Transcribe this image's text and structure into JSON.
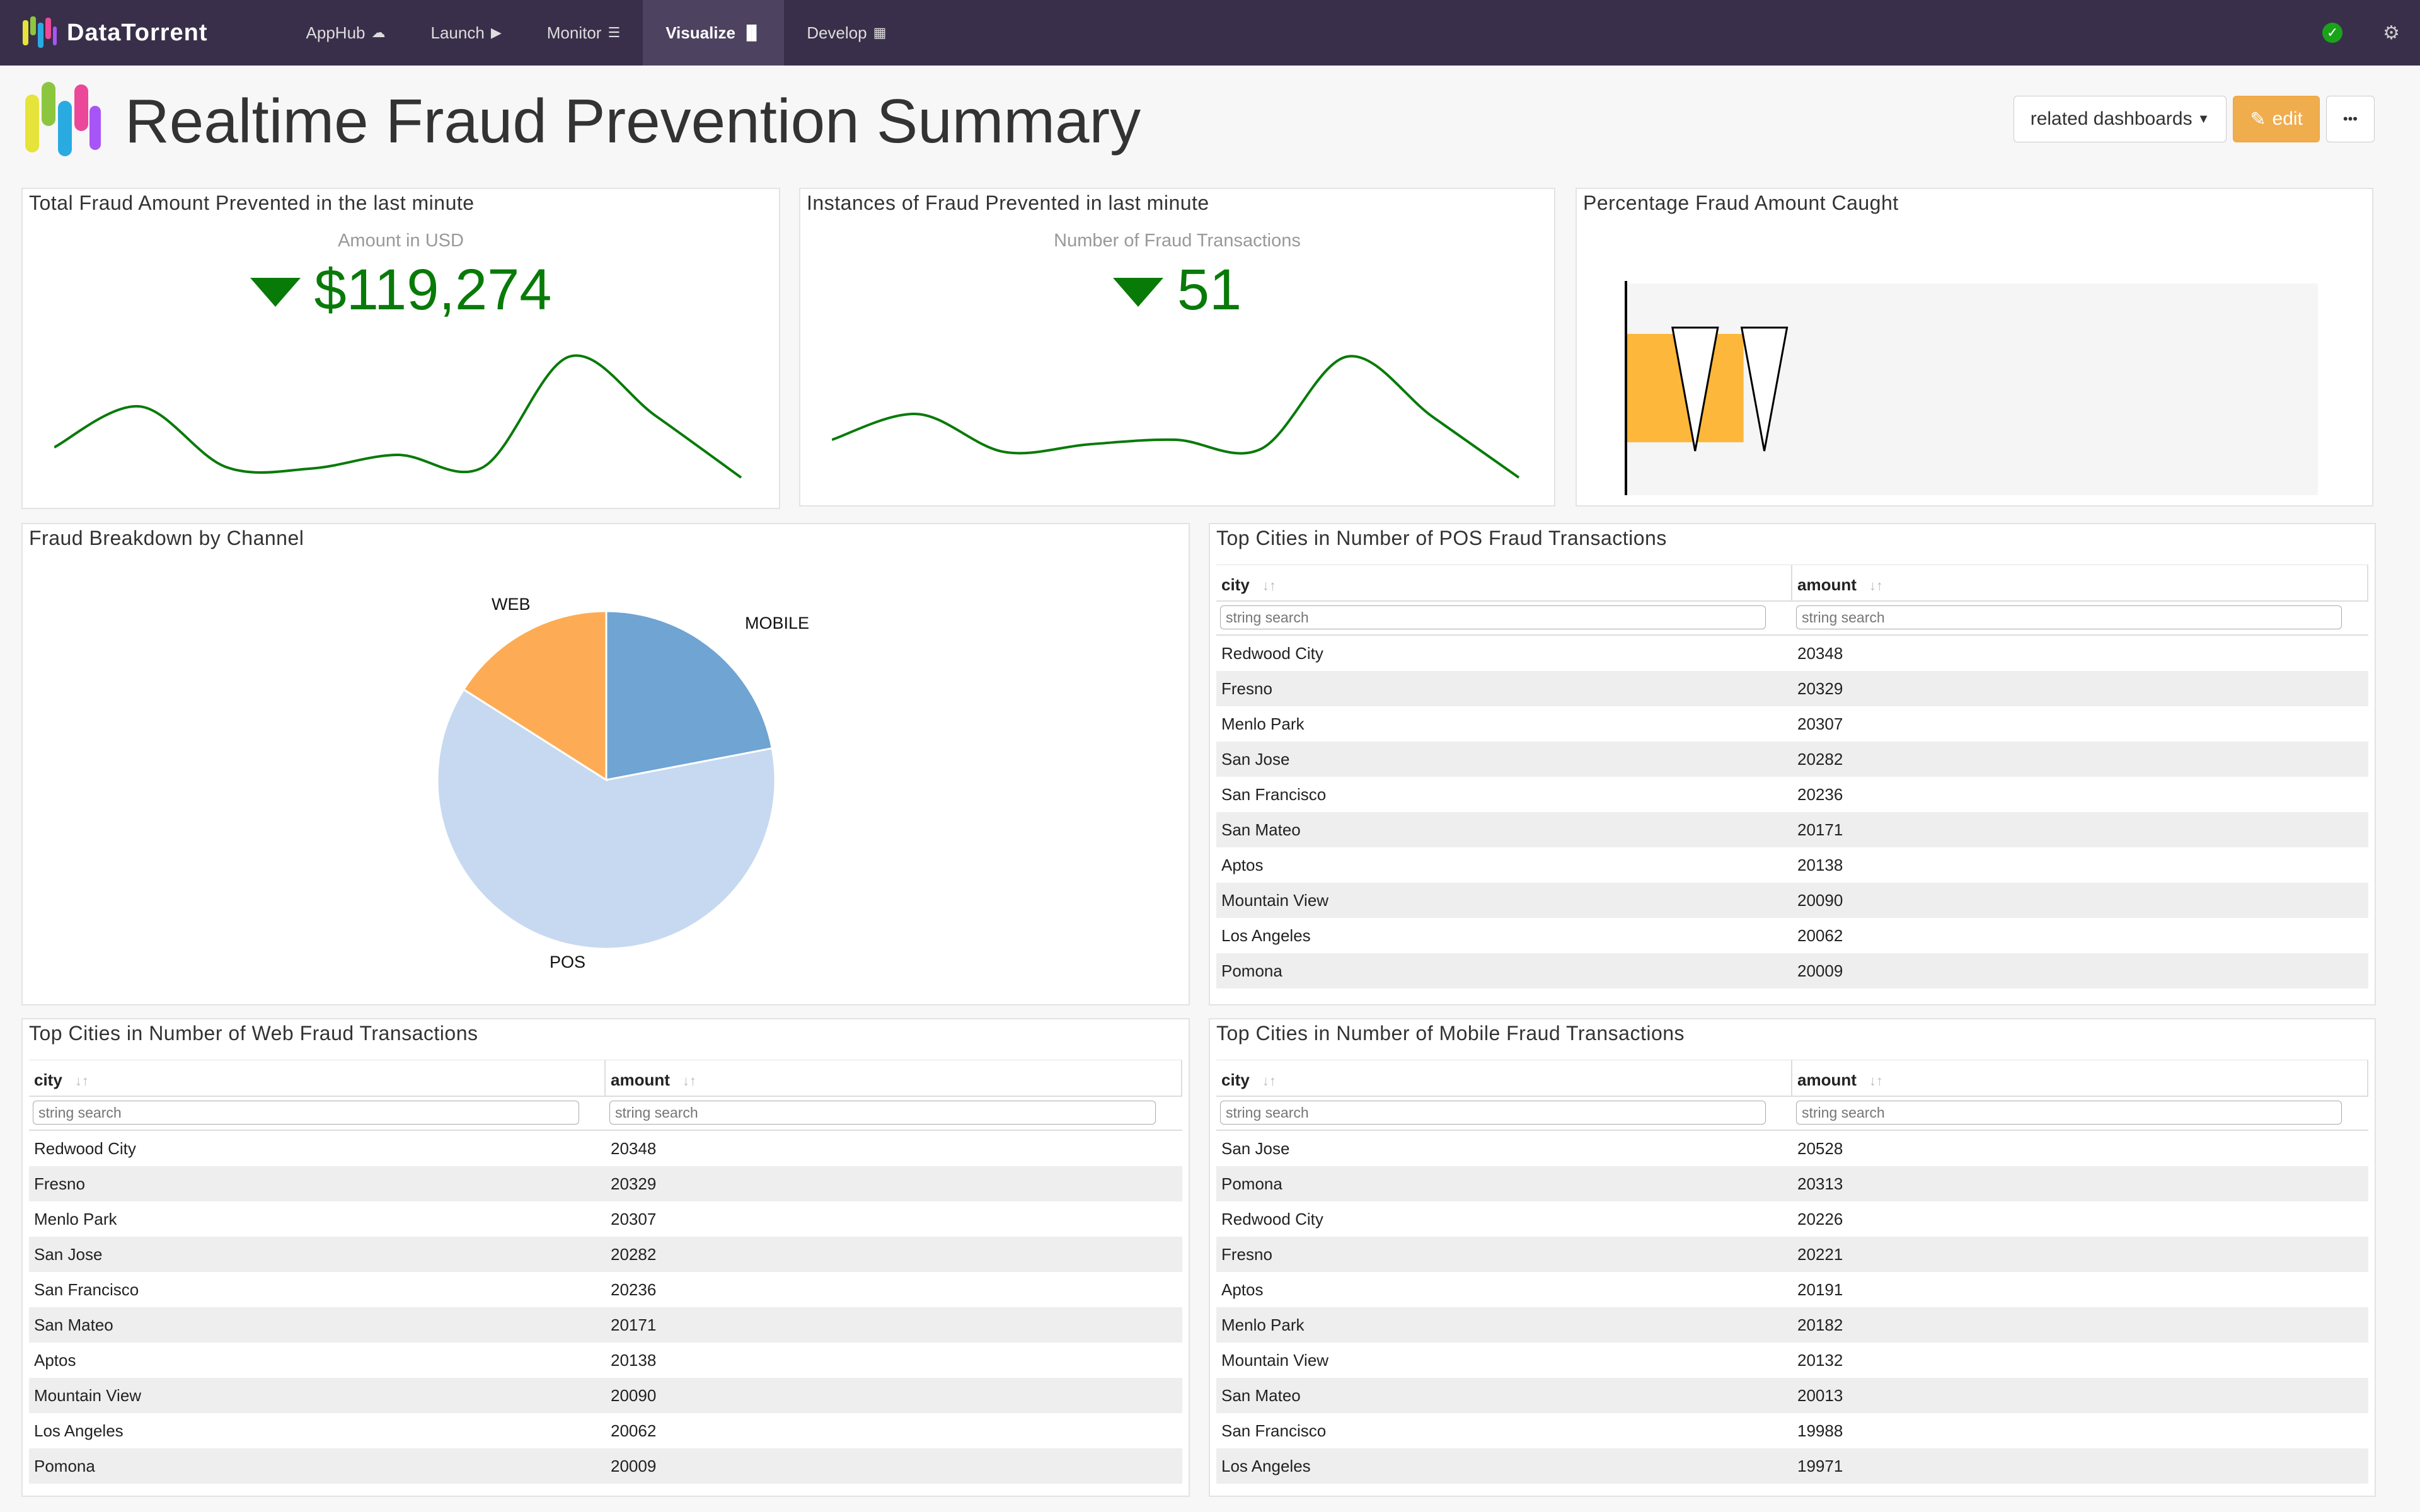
{
  "app": {
    "brand": "DataTorrent",
    "nav": [
      {
        "label": "AppHub",
        "icon": "☁"
      },
      {
        "label": "Launch",
        "icon": "▶"
      },
      {
        "label": "Monitor",
        "icon": "☰"
      },
      {
        "label": "Visualize",
        "icon": "📊"
      },
      {
        "label": "Develop",
        "icon": "▦"
      }
    ],
    "active_nav": "Visualize"
  },
  "header": {
    "title": "Realtime Fraud Prevention Summary",
    "related_label": "related dashboards",
    "edit_label": "edit",
    "more_label": "•••"
  },
  "widgets": {
    "total_amount": {
      "title": "Total Fraud Amount Prevented in the last minute",
      "subtitle": "Amount in USD",
      "value": "$119,274",
      "trend": [
        0.25,
        0.52,
        0.12,
        0.11,
        0.2,
        0.12,
        0.85,
        0.46,
        0.05
      ]
    },
    "instances": {
      "title": "Instances of Fraud Prevented in last minute",
      "subtitle": "Number of Fraud Transactions",
      "value": "51",
      "trend": [
        0.3,
        0.47,
        0.22,
        0.27,
        0.3,
        0.24,
        0.85,
        0.45,
        0.05
      ]
    },
    "percentage": {
      "title": "Percentage Fraud Amount Caught",
      "chart_data": {
        "type": "bullet",
        "value": 17,
        "markers": [
          10,
          20
        ],
        "xlim": [
          0,
          100
        ],
        "ticks": [
          "0",
          "10",
          "20",
          "30",
          "40",
          "50",
          "60",
          "70",
          "80",
          "90",
          "100"
        ]
      }
    },
    "breakdown": {
      "title": "Fraud Breakdown by Channel",
      "chart_data": {
        "type": "pie",
        "categories": [
          "MOBILE",
          "POS",
          "WEB"
        ],
        "values": [
          22,
          62,
          16
        ],
        "colors": [
          "#6fa4d3",
          "#c6d9f0",
          "#fdac55"
        ]
      }
    },
    "pos_table": {
      "title": "Top Cities in Number of POS Fraud Transactions",
      "columns": [
        "city",
        "amount"
      ],
      "placeholder": "string search",
      "rows": [
        [
          "Redwood City",
          "20348"
        ],
        [
          "Fresno",
          "20329"
        ],
        [
          "Menlo Park",
          "20307"
        ],
        [
          "San Jose",
          "20282"
        ],
        [
          "San Francisco",
          "20236"
        ],
        [
          "San Mateo",
          "20171"
        ],
        [
          "Aptos",
          "20138"
        ],
        [
          "Mountain View",
          "20090"
        ],
        [
          "Los Angeles",
          "20062"
        ],
        [
          "Pomona",
          "20009"
        ]
      ]
    },
    "web_table": {
      "title": "Top Cities in Number of Web Fraud Transactions",
      "columns": [
        "city",
        "amount"
      ],
      "placeholder": "string search",
      "rows": [
        [
          "Redwood City",
          "20348"
        ],
        [
          "Fresno",
          "20329"
        ],
        [
          "Menlo Park",
          "20307"
        ],
        [
          "San Jose",
          "20282"
        ],
        [
          "San Francisco",
          "20236"
        ],
        [
          "San Mateo",
          "20171"
        ],
        [
          "Aptos",
          "20138"
        ],
        [
          "Mountain View",
          "20090"
        ],
        [
          "Los Angeles",
          "20062"
        ],
        [
          "Pomona",
          "20009"
        ]
      ]
    },
    "mobile_table": {
      "title": "Top Cities in Number of Mobile Fraud Transactions",
      "columns": [
        "city",
        "amount"
      ],
      "placeholder": "string search",
      "rows": [
        [
          "San Jose",
          "20528"
        ],
        [
          "Pomona",
          "20313"
        ],
        [
          "Redwood City",
          "20226"
        ],
        [
          "Fresno",
          "20221"
        ],
        [
          "Aptos",
          "20191"
        ],
        [
          "Menlo Park",
          "20182"
        ],
        [
          "Mountain View",
          "20132"
        ],
        [
          "San Mateo",
          "20013"
        ],
        [
          "San Francisco",
          "19988"
        ],
        [
          "Los Angeles",
          "19971"
        ]
      ]
    }
  }
}
